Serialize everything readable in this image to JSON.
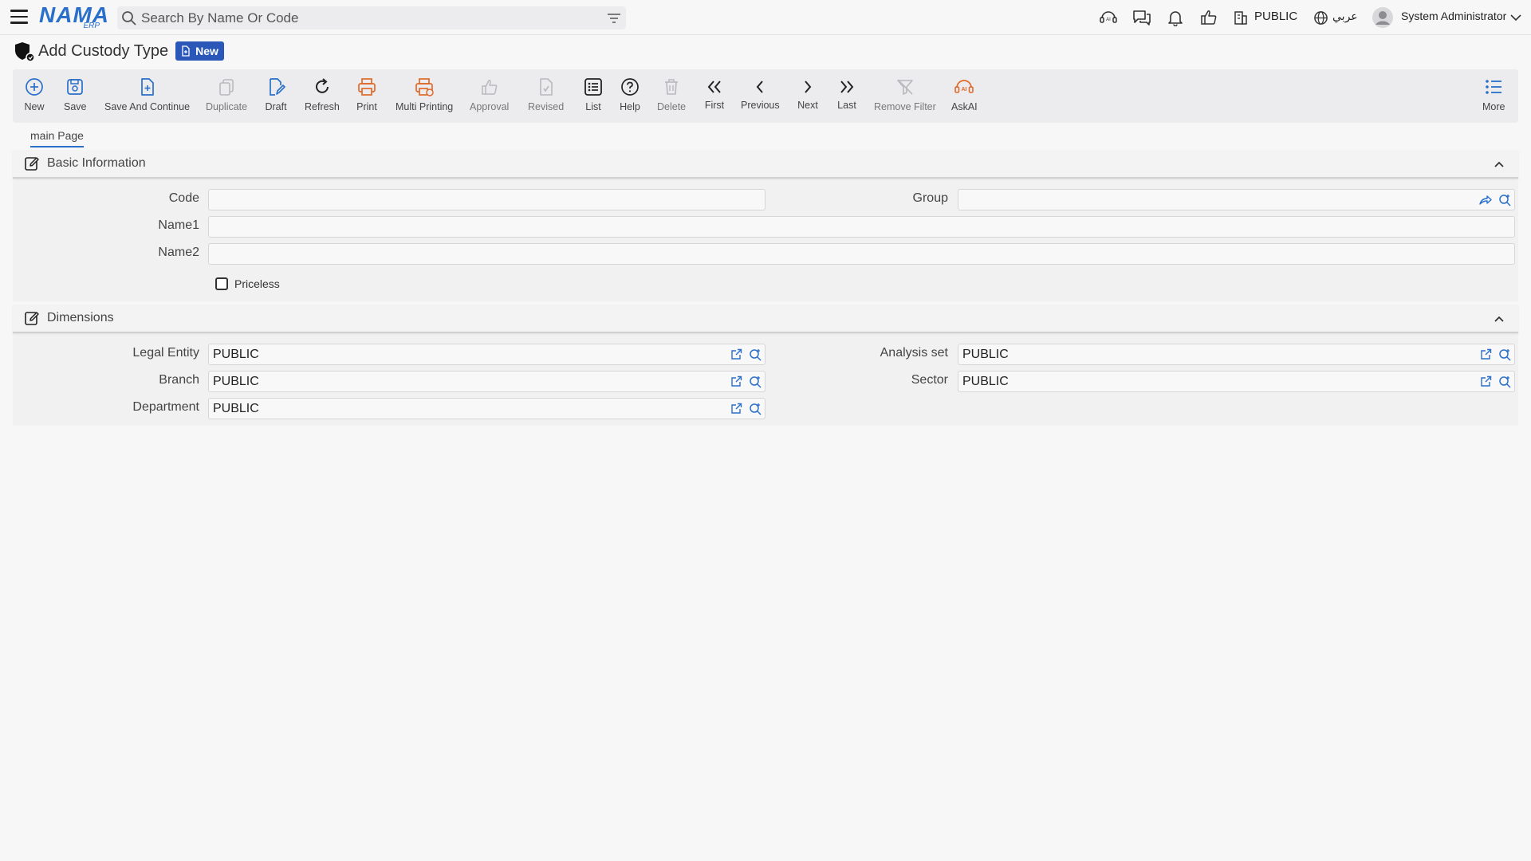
{
  "topbar": {
    "logo_main": "NAMA",
    "logo_sub": "ERP",
    "search_placeholder": "Search By Name Or Code",
    "company": "PUBLIC",
    "language": "عربي",
    "user": "System Administrator",
    "icons": [
      "menu-icon",
      "search-icon",
      "filter-icon",
      "ai-icon",
      "chat-icon",
      "bell-icon",
      "thumbs-up-icon",
      "building-icon",
      "globe-icon",
      "user-avatar-icon",
      "chevron-down-icon"
    ]
  },
  "page": {
    "title": "Add Custody Type",
    "badge": "New"
  },
  "toolbar": {
    "new": "New",
    "save": "Save",
    "save_continue": "Save And Continue",
    "duplicate": "Duplicate",
    "draft": "Draft",
    "refresh": "Refresh",
    "print": "Print",
    "multi_printing": "Multi Printing",
    "approval": "Approval",
    "revised": "Revised",
    "list": "List",
    "help": "Help",
    "delete": "Delete",
    "first": "First",
    "previous": "Previous",
    "next": "Next",
    "last": "Last",
    "remove_filter": "Remove Filter",
    "askai": "AskAI",
    "more": "More"
  },
  "tabs": [
    {
      "label": "main Page"
    }
  ],
  "basic": {
    "title": "Basic Information",
    "code_label": "Code",
    "code_value": "",
    "group_label": "Group",
    "group_value": "",
    "name1_label": "Name1",
    "name1_value": "",
    "name2_label": "Name2",
    "name2_value": "",
    "priceless_label": "Priceless",
    "priceless_checked": false
  },
  "dimensions": {
    "title": "Dimensions",
    "legal_entity_label": "Legal Entity",
    "legal_entity_value": "PUBLIC",
    "analysis_set_label": "Analysis set",
    "analysis_set_value": "PUBLIC",
    "branch_label": "Branch",
    "branch_value": "PUBLIC",
    "sector_label": "Sector",
    "sector_value": "PUBLIC",
    "department_label": "Department",
    "department_value": "PUBLIC"
  },
  "colors": {
    "accent": "#2a6fc9",
    "badge": "#2a57b8",
    "print_orange": "#e06a2c",
    "disabled": "#b9b9bd"
  }
}
